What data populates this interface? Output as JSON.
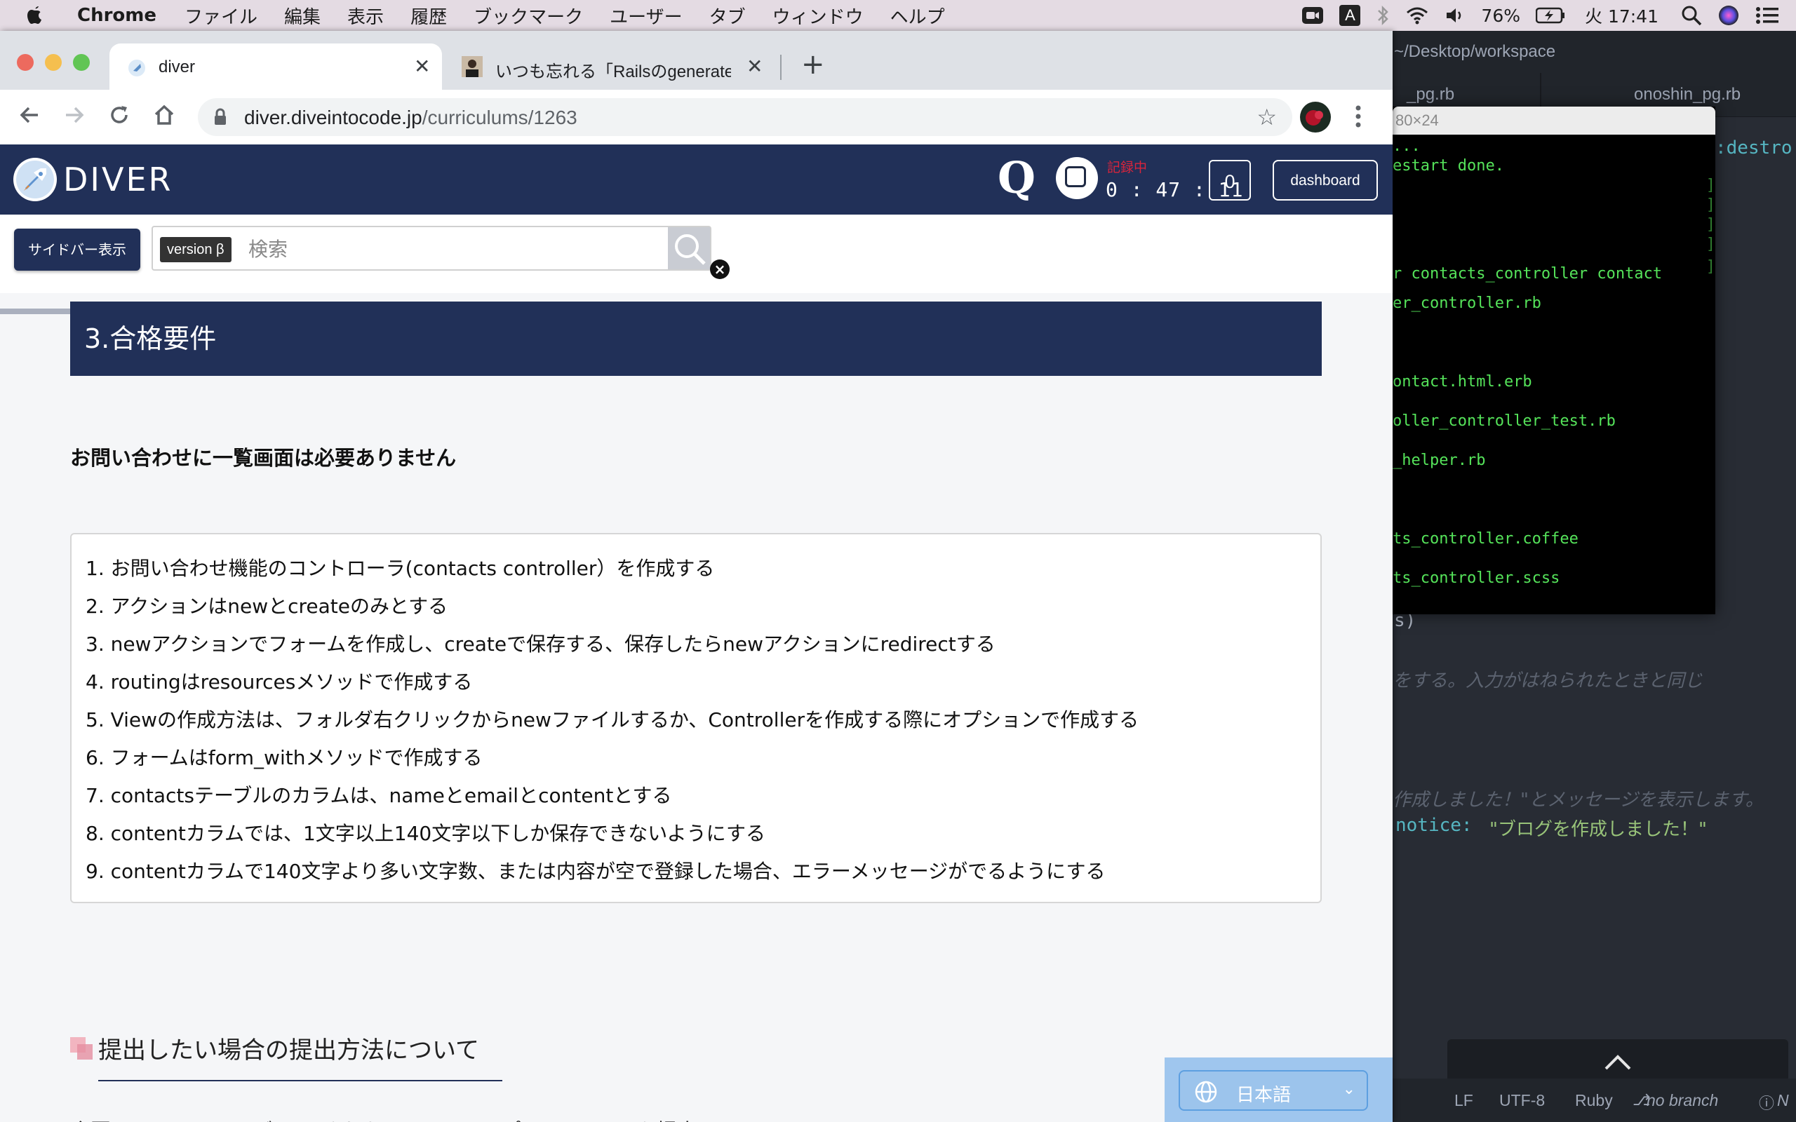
{
  "menubar": {
    "app_name": "Chrome",
    "items": [
      "ファイル",
      "編集",
      "表示",
      "履歴",
      "ブックマーク",
      "ユーザー",
      "タブ",
      "ウィンドウ",
      "ヘルプ"
    ],
    "battery": "76%",
    "clock": "火 17:41",
    "input_indicator": "A"
  },
  "browser": {
    "tabs": [
      {
        "title": "diver",
        "active": true
      },
      {
        "title": "いつも忘れる「Railsのgenerateコ",
        "active": false
      }
    ],
    "url_host": "diver.diveintocode.jp",
    "url_path": "/curriculums/1263"
  },
  "site": {
    "logo_text": "DIVER",
    "q_label": "Q",
    "rec_status": "記録中",
    "rec_time": "0 : 47 : 11",
    "count": "0",
    "dashboard_label": "dashboard",
    "sidebar_button": "サイドバー表示",
    "version_badge": "version β",
    "search_placeholder": "検索",
    "close_mark": "×"
  },
  "content": {
    "section_title": "3.合格要件",
    "bold_note": "お問い合わせに一覧画面は必要ありません",
    "requirements": [
      "1. お問い合わせ機能のコントローラ(contacts controller）を作成する",
      "2. アクションはnewとcreateのみとする",
      "3. newアクションでフォームを作成し、createで保存する、保存したらnewアクションにredirectする",
      "4. routingはresourcesメソッドで作成する",
      "5. Viewの作成方法は、フォルダ右クリックからnewファイルするか、Controllerを作成する際にオプションで作成する",
      "6. フォームはform_withメソッドで作成する",
      "7. contactsテーブルのカラムは、nameとemailとcontentとする",
      "8. contentカラムでは、1文字以上140文字以下しか保存できないようにする",
      "9. contentカラムで140文字より多い文字数、または内容が空で登録した場合、エラーメッセージがでるようにする"
    ],
    "submit_heading": "提出したい場合の提出方法について",
    "submit_desc": "今回のソースコードがpushされた github のリポジトリ URL を提出",
    "language": "日本語"
  },
  "editor": {
    "window_title": "~/Desktop/workspace",
    "tab_left": "_pg.rb",
    "tab_right": "onoshin_pg.rb",
    "destroy_fragment": ":destro",
    "paren_fragment": "s)",
    "comment1": "をする。入力がはねられたときと同じ",
    "comment2": "作成しました！\"とメッセージを表示します。",
    "notice_key": "notice:",
    "notice_value": "\"ブログを作成しました！\"",
    "status": {
      "lf": "LF",
      "encoding": "UTF-8",
      "grammar": "Ruby",
      "branch": "no branch",
      "extra": "N"
    }
  },
  "terminal": {
    "title": "80×24",
    "lines": [
      "...",
      "estart done.",
      "r contacts_controller contact",
      "er_controller.rb",
      "ontact.html.erb",
      "oller_controller_test.rb",
      "_helper.rb",
      "ts_controller.coffee",
      "ts_controller.scss"
    ]
  }
}
